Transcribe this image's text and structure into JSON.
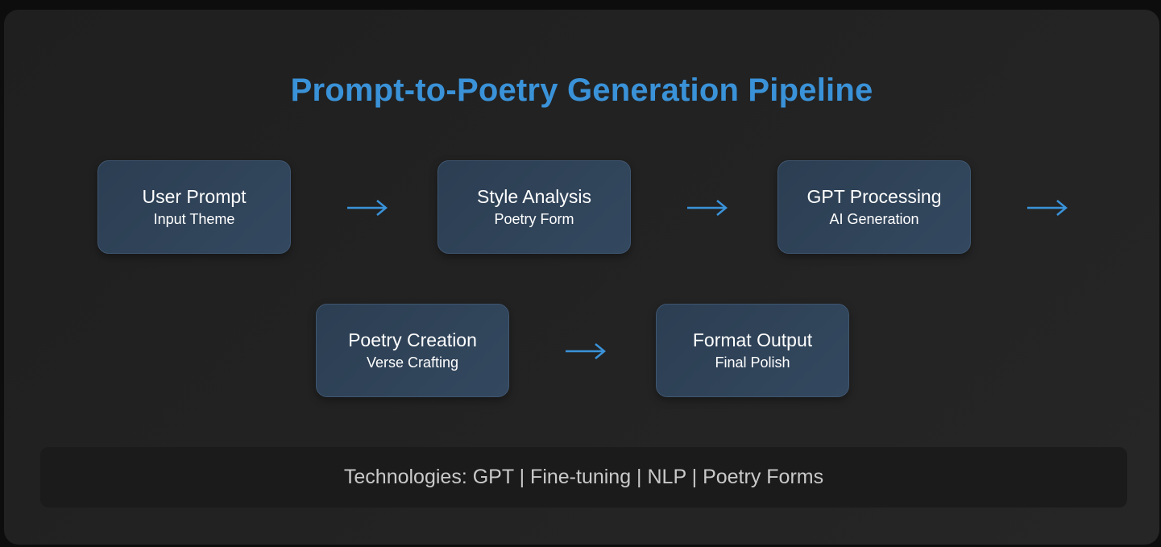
{
  "title": "Prompt-to-Poetry Generation Pipeline",
  "steps": [
    {
      "title": "User Prompt",
      "subtitle": "Input Theme"
    },
    {
      "title": "Style Analysis",
      "subtitle": "Poetry Form"
    },
    {
      "title": "GPT Processing",
      "subtitle": "AI Generation"
    },
    {
      "title": "Poetry Creation",
      "subtitle": "Verse Crafting"
    },
    {
      "title": "Format Output",
      "subtitle": "Final Polish"
    }
  ],
  "technologies": "Technologies: GPT | Fine-tuning | NLP | Poetry Forms",
  "colors": {
    "accent": "#3a92d8",
    "box": "#2c3e52",
    "background": "#232323"
  },
  "icons": {
    "arrow": "right-arrow-icon"
  }
}
